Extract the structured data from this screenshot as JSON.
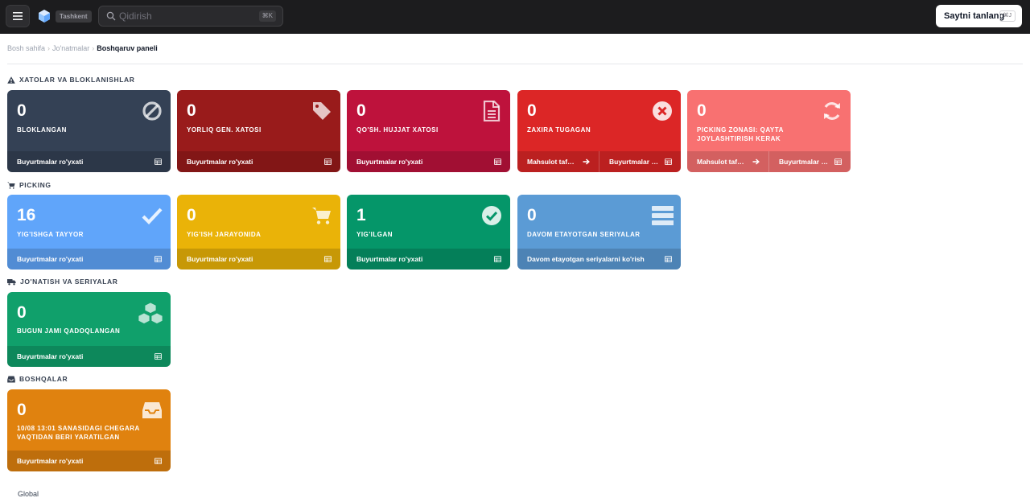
{
  "header": {
    "location_badge": "Tashkent",
    "search_placeholder": "Qidirish",
    "search_shortcut": "⌘K",
    "site_button_label": "Saytni tanlang",
    "site_shortcut": "⌘J"
  },
  "breadcrumb": {
    "home": "Bosh sahifa",
    "shipments": "Jo'natmalar",
    "current": "Boshqaruv paneli"
  },
  "sections": {
    "errors": "XATOLAR VA BLOKLANISHLAR",
    "picking": "PICKING",
    "shipping": "JO'NATISH VA SERIYALAR",
    "other": "BOSHQALAR"
  },
  "cards": {
    "blocked": {
      "count": "0",
      "label": "BLOKLANGAN",
      "icon": "ban-icon",
      "color": "#344155",
      "footer": [
        "Buyurtmalar ro'yxati"
      ]
    },
    "label_error": {
      "count": "0",
      "label": "YORLIQ GEN. XATOSI",
      "icon": "tag-icon",
      "color": "#991b1b",
      "footer": [
        "Buyurtmalar ro'yxati"
      ]
    },
    "doc_error": {
      "count": "0",
      "label": "QO'SH. HUJJAT XATOSI",
      "icon": "document-icon",
      "color": "#be123c",
      "footer": [
        "Buyurtmalar ro'yxati"
      ]
    },
    "out_of_stock": {
      "count": "0",
      "label": "ZAXIRA TUGAGAN",
      "icon": "x-circle-icon",
      "color": "#dc2626",
      "footer": [
        "Mahsulot tafsilotlari",
        "Buyurtmalar ro'yxati"
      ]
    },
    "relocation": {
      "count": "0",
      "label": "PICKING ZONASI: QAYTA JOYLASHTIRISH KERAK",
      "icon": "refresh-icon",
      "color": "#f87171",
      "footer": [
        "Mahsulot tafsilotlari",
        "Buyurtmalar ro'yxati"
      ]
    },
    "ready_to_pick": {
      "count": "16",
      "label": "YIG'ISHGA TAYYOR",
      "icon": "check-icon",
      "color": "#60a5fa",
      "footer": [
        "Buyurtmalar ro'yxati"
      ]
    },
    "picking_in_progress": {
      "count": "0",
      "label": "YIG'ISH JARAYONIDA",
      "icon": "cart-icon",
      "color": "#eab308",
      "footer": [
        "Buyurtmalar ro'yxati"
      ]
    },
    "picked": {
      "count": "1",
      "label": "YIG'ILGAN",
      "icon": "check-circle-icon",
      "color": "#059669",
      "footer": [
        "Buyurtmalar ro'yxati"
      ]
    },
    "ongoing_series": {
      "count": "0",
      "label": "DAVOM ETAYOTGAN SERIYALAR",
      "icon": "server-icon",
      "color": "#5b9bd5",
      "footer": [
        "Davom etayotgan seriyalarni ko'rish"
      ]
    },
    "packed_today": {
      "count": "0",
      "label": "BUGUN JAMI QADOQLANGAN",
      "icon": "cubes-icon",
      "color": "#10a06b",
      "footer": [
        "Buyurtmalar ro'yxati"
      ]
    },
    "created_since": {
      "count": "0",
      "label": "10/08 13:01 SANASIDAGI CHEGARA VAQTIDAN BERI YARATILGAN",
      "icon": "inbox-icon",
      "color": "#e0820f",
      "footer": [
        "Buyurtmalar ro'yxati"
      ]
    }
  },
  "footer": {
    "label": "Global"
  }
}
